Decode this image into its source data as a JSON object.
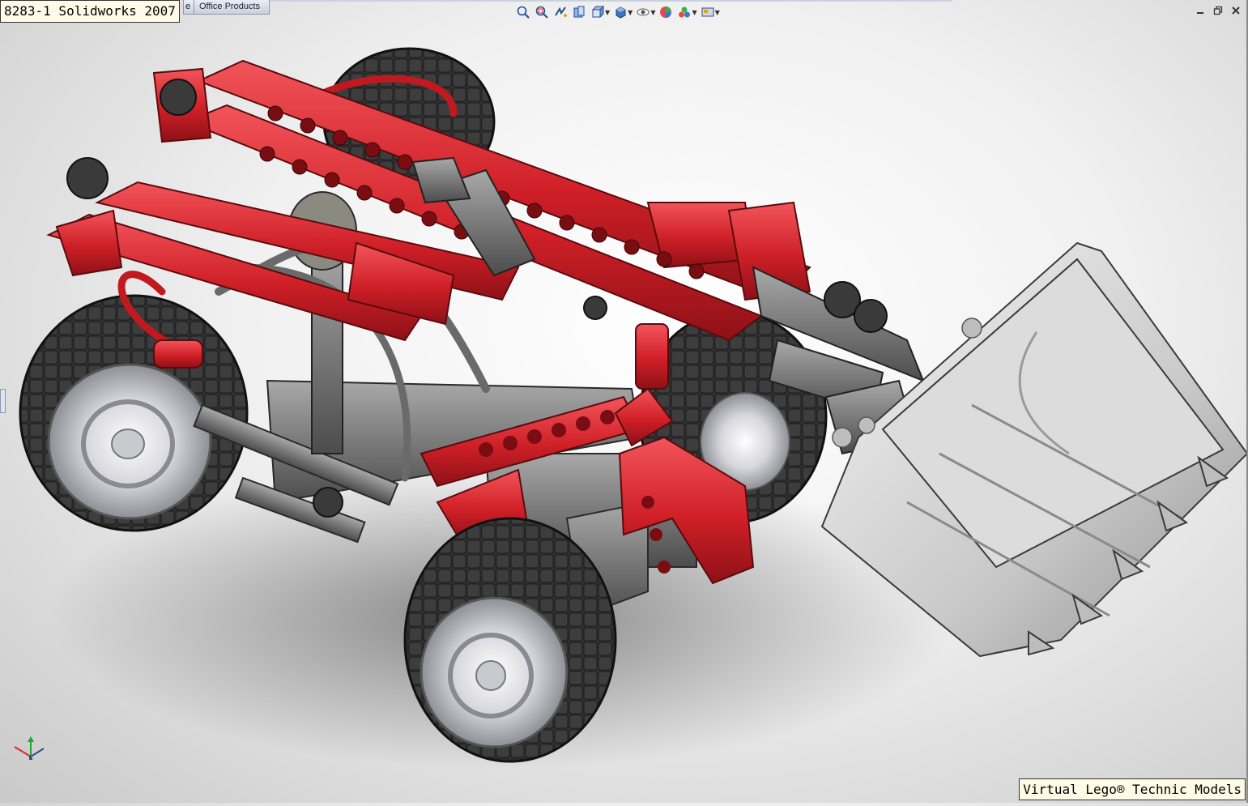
{
  "title_box": "8283-1 Solidworks 2007",
  "tabs": {
    "partial_label": "e",
    "office_products": "Office Products"
  },
  "heads_up_toolbar": [
    "zoom-to-fit-icon",
    "zoom-to-area-icon",
    "previous-view-icon",
    "section-view-icon",
    "view-orientation-icon",
    "display-style-icon",
    "hide-show-items-icon",
    "edit-appearance-icon",
    "apply-scene-icon",
    "view-settings-icon"
  ],
  "window_controls": [
    "minimize-icon",
    "restore-icon",
    "close-icon"
  ],
  "watermark": "Virtual Lego® Technic Models",
  "colors": {
    "technic_red": "#d42a2f",
    "tyre_dark": "#2b2b2b",
    "bucket_grey": "#c8c8c8",
    "beam_grey": "#6f6f6f"
  }
}
